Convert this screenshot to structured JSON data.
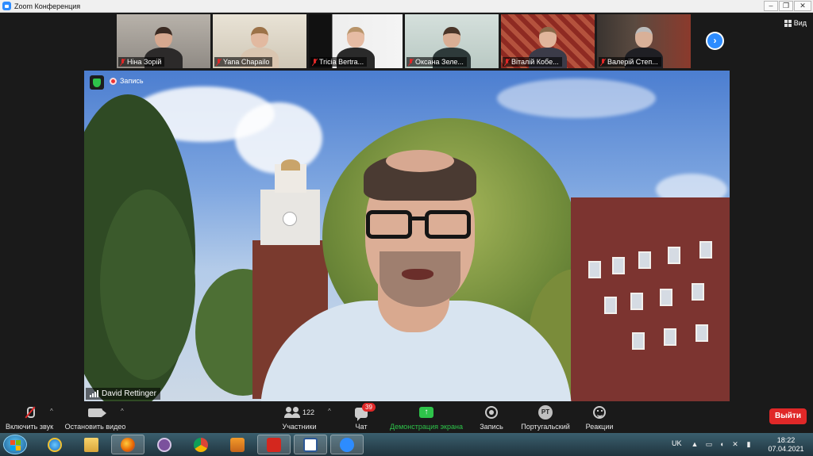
{
  "window": {
    "title": "Zoom Конференция",
    "minimize": "–",
    "maximize": "❐",
    "close": "✕"
  },
  "view_button": {
    "label": "Вид"
  },
  "participants_strip": [
    {
      "name": "Ніна Зорій",
      "muted": true
    },
    {
      "name": "Yana Chapailo",
      "muted": true
    },
    {
      "name": "Tricia Bertra...",
      "muted": true
    },
    {
      "name": "Оксана Зеле...",
      "muted": true
    },
    {
      "name": "Віталій Кобе...",
      "muted": true
    },
    {
      "name": "Валерій Степ...",
      "muted": true
    }
  ],
  "next_page": "›",
  "main_video": {
    "recording_label": "Запись",
    "speaker_name": "David Rettinger"
  },
  "toolbar": {
    "unmute": {
      "label": "Включить звук",
      "caret": "^"
    },
    "video": {
      "label": "Остановить видео",
      "caret": "^"
    },
    "participants": {
      "label": "Участники",
      "count": "122",
      "caret": "^"
    },
    "chat": {
      "label": "Чат",
      "badge": "39"
    },
    "share": {
      "label": "Демонстрация экрана",
      "arrow": "↑"
    },
    "record": {
      "label": "Запись"
    },
    "interpretation": {
      "label": "Португальский",
      "icon_text": "PT"
    },
    "reactions": {
      "label": "Реакции"
    },
    "leave": {
      "label": "Выйти"
    }
  },
  "taskbar": {
    "language": "UK",
    "time": "18:22",
    "date": "07.04.2021",
    "apps": [
      "ie-icon",
      "explorer-icon",
      "firefox-icon",
      "viber-icon",
      "chrome-icon",
      "media-player-icon",
      "acrobat-icon",
      "word-icon",
      "zoom-icon"
    ]
  },
  "colors": {
    "accent": "#2d8cff",
    "share_green": "#2ec34a",
    "leave_red": "#e02828",
    "mute_red": "#e02828"
  }
}
